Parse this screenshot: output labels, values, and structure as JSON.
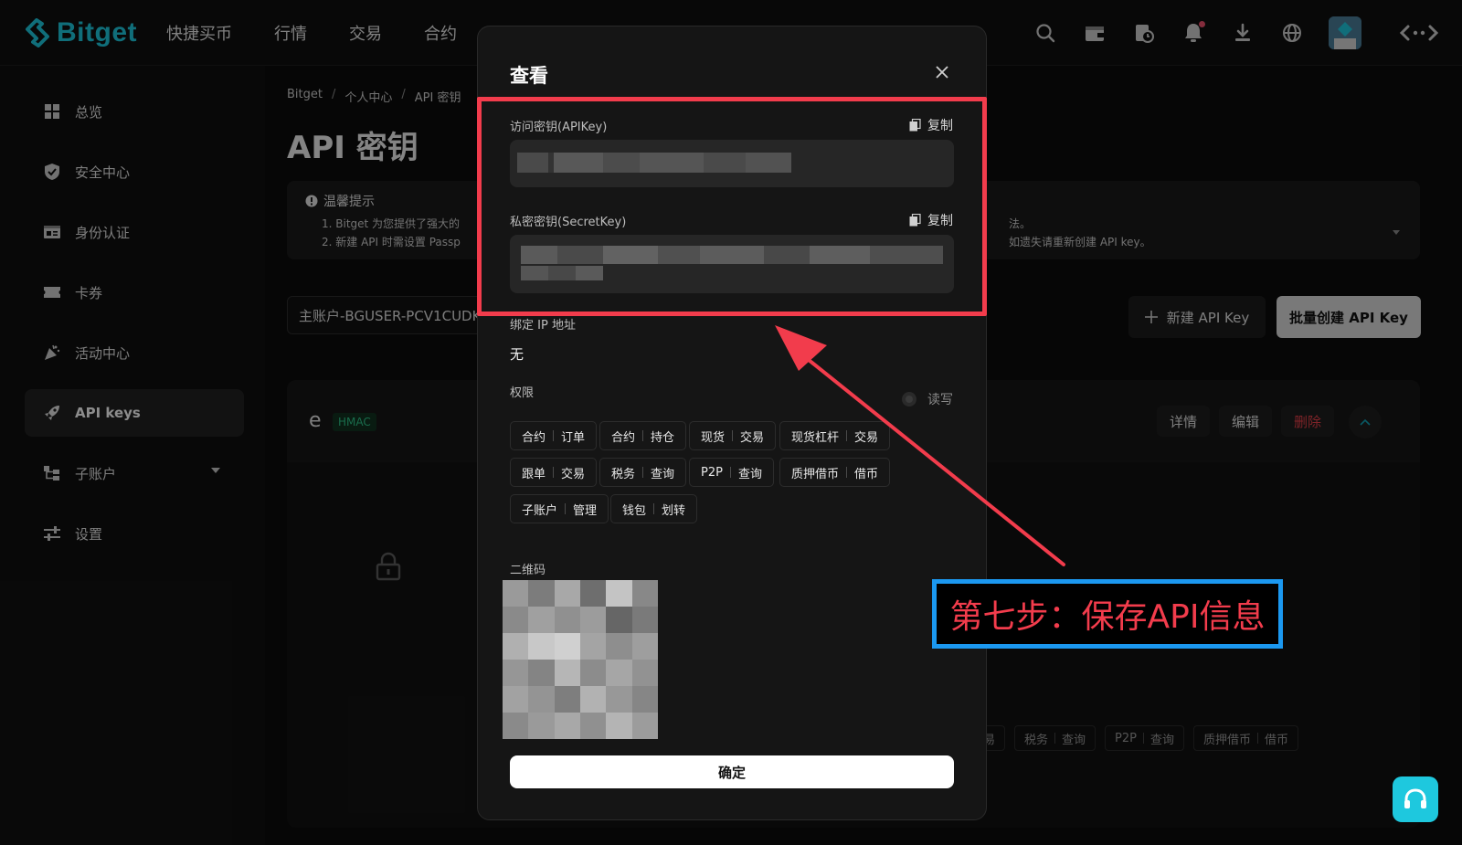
{
  "brand": {
    "name": "Bitget",
    "accent": "#1ec8de"
  },
  "nav": [
    "快捷买币",
    "行情",
    "交易",
    "合约"
  ],
  "top_icons": [
    "search-icon",
    "wallet-icon",
    "orders-icon",
    "bell-icon",
    "download-icon",
    "globe-icon",
    "avatar"
  ],
  "sidebar": {
    "items": [
      {
        "label": "总览",
        "icon": "grid-icon"
      },
      {
        "label": "安全中心",
        "icon": "shield-icon"
      },
      {
        "label": "身份认证",
        "icon": "id-card-icon"
      },
      {
        "label": "卡券",
        "icon": "ticket-icon"
      },
      {
        "label": "活动中心",
        "icon": "party-icon"
      },
      {
        "label": "API keys",
        "icon": "rocket-icon",
        "active": true
      },
      {
        "label": "子账户",
        "icon": "subaccount-icon"
      },
      {
        "label": "设置",
        "icon": "sliders-icon"
      }
    ]
  },
  "main": {
    "breadcrumb": [
      "Bitget",
      "个人中心",
      "API 密钥"
    ],
    "title": "API 密钥",
    "notice": {
      "title": "温馨提示",
      "line1": "1. Bitget 为您提供了强大的",
      "line2": "2. 新建 API 时需设置 Passp",
      "line1_tail": "法。",
      "line2_tail": "如遗失请重新创建 API key。"
    },
    "account_select": "主账户-BGUSER-PCV1CUDK",
    "new_key_label": "新建 API Key",
    "batch_create_label": "批量创建 API Key",
    "card": {
      "name": "e",
      "tag": "HMAC",
      "details_label": "详情",
      "edit_label": "编辑",
      "delete_label": "删除",
      "bg_tags": [
        [
          "交易",
          ""
        ],
        [
          "税务",
          "查询"
        ],
        [
          "P2P",
          "查询"
        ],
        [
          "质押借币",
          "借币"
        ]
      ]
    }
  },
  "modal": {
    "title": "查看",
    "api_key_label": "访问密钥(APIKey)",
    "secret_key_label": "私密密钥(SecretKey)",
    "copy_label": "复制",
    "ip_label": "绑定 IP 地址",
    "ip_value": "无",
    "permissions_label": "权限",
    "read_write_label": "读写",
    "permissions": [
      [
        "合约",
        "订单"
      ],
      [
        "合约",
        "持仓"
      ],
      [
        "现货",
        "交易"
      ],
      [
        "现货杠杆",
        "交易"
      ],
      [
        "跟单",
        "交易"
      ],
      [
        "税务",
        "查询"
      ],
      [
        "P2P",
        "查询"
      ],
      [
        "质押借币",
        "借币"
      ],
      [
        "子账户",
        "管理"
      ],
      [
        "钱包",
        "划转"
      ]
    ],
    "qr_label": "二维码",
    "confirm_label": "确定"
  },
  "annotation": {
    "step_text": "第七步：保存API信息",
    "frame_color": "#f23c4c",
    "box_color": "#1b98f0"
  }
}
